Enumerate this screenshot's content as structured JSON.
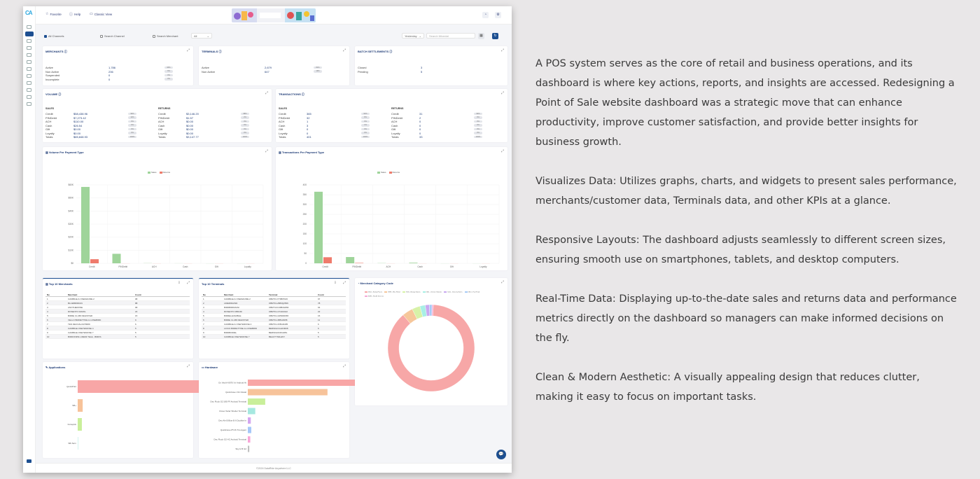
{
  "app": {
    "logo": "CA"
  },
  "topbar": {
    "favorite": "Favorite",
    "help": "Help",
    "classic": "Classic View"
  },
  "filters": {
    "all_channels": "All Channels",
    "search_channel": "Search Channel",
    "search_merchant": "Search Merchant",
    "all": "All",
    "period": "Yesterday",
    "date_placeholder": "Search Mixedat"
  },
  "merchants": {
    "title": "MERCHANTS",
    "rows": [
      {
        "label": "Active",
        "value": "1,786",
        "pill": "93%"
      },
      {
        "label": "Non Active",
        "value": "236",
        "pill": "6%"
      },
      {
        "label": "Suspended",
        "value": "0",
        "pill": "0%"
      },
      {
        "label": "Incomplete",
        "value": "0",
        "pill": "0%"
      }
    ]
  },
  "terminals": {
    "title": "TERMINALS",
    "rows": [
      {
        "label": "Active",
        "value": "2,679",
        "pill": "81%"
      },
      {
        "label": "Non Active",
        "value": "647",
        "pill": "19%"
      }
    ]
  },
  "batch": {
    "title": "BATCH SETTLEMENTS",
    "rows": [
      {
        "label": "Closed",
        "value": "3"
      },
      {
        "label": "Pending",
        "value": "5"
      }
    ]
  },
  "volume": {
    "title": "VOLUME",
    "sales_h": "SALES",
    "returns_h": "RETURNS",
    "sales": [
      {
        "label": "Credit",
        "value": "$58,438.96",
        "pill": "94%"
      },
      {
        "label": "PINDebit",
        "value": "$7,273.42",
        "pill": "12%"
      },
      {
        "label": "ACH",
        "value": "$110.00",
        "pill": "0%"
      },
      {
        "label": "Cash",
        "value": "$26.54",
        "pill": "0%"
      },
      {
        "label": "Gift",
        "value": "$0.00",
        "pill": "0%"
      },
      {
        "label": "Loyalty",
        "value": "$0.00",
        "pill": "0%"
      },
      {
        "label": "Totals",
        "value": "$65,848.93",
        "pill": "100%"
      }
    ],
    "returns": [
      {
        "label": "Credit",
        "value": "$3,146.20",
        "pill": "98%"
      },
      {
        "label": "PINDebit",
        "value": "$1.57",
        "pill": "2%"
      },
      {
        "label": "ACH",
        "value": "$0.00",
        "pill": "0%"
      },
      {
        "label": "Cash",
        "value": "$0.00",
        "pill": "0%"
      },
      {
        "label": "Gift",
        "value": "$0.00",
        "pill": "0%"
      },
      {
        "label": "Loyalty",
        "value": "$0.00",
        "pill": "0%"
      },
      {
        "label": "Totals",
        "value": "$3,147.77",
        "pill": "100%"
      }
    ]
  },
  "transactions": {
    "title": "TRANSACTIONS",
    "sales_h": "SALES",
    "returns_h": "RETURNS",
    "sales": [
      {
        "label": "Credit",
        "value": "365",
        "pill": "91%"
      },
      {
        "label": "PINDebit",
        "value": "32",
        "pill": "8%"
      },
      {
        "label": "ACH",
        "value": "1",
        "pill": "0%"
      },
      {
        "label": "Cash",
        "value": "3",
        "pill": "1%"
      },
      {
        "label": "Gift",
        "value": "0",
        "pill": "0%"
      },
      {
        "label": "Loyalty",
        "value": "0",
        "pill": "0%"
      },
      {
        "label": "Totals",
        "value": "401",
        "pill": "100%"
      }
    ],
    "returns": [
      {
        "label": "Credit",
        "value": "31",
        "pill": "94%"
      },
      {
        "label": "PINDebit",
        "value": "2",
        "pill": "6%"
      },
      {
        "label": "ACH",
        "value": "0",
        "pill": "0%"
      },
      {
        "label": "Cash",
        "value": "0",
        "pill": "0%"
      },
      {
        "label": "Gift",
        "value": "0",
        "pill": "0%"
      },
      {
        "label": "Loyalty",
        "value": "0",
        "pill": "0%"
      },
      {
        "label": "Totals",
        "value": "33",
        "pill": "100%"
      }
    ]
  },
  "colors": {
    "sales": "#9fd49a",
    "returns": "#ef7b6c",
    "accent": "#1d4f91"
  },
  "chart_data": [
    {
      "type": "bar",
      "title": "Volume Per Payment Type",
      "categories": [
        "Credit",
        "PINDebit",
        "ACH",
        "Cash",
        "Gift",
        "Loyalty"
      ],
      "series": [
        {
          "name": "Sales",
          "values": [
            58438.96,
            7273.42,
            110,
            26.54,
            0,
            0
          ]
        },
        {
          "name": "Returns",
          "values": [
            3146.2,
            1.57,
            0,
            0,
            0,
            0
          ]
        }
      ],
      "yticks": [
        "$0",
        "$10K",
        "$20K",
        "$30K",
        "$40K",
        "$50K",
        "$60K"
      ],
      "ylim": [
        0,
        60000
      ]
    },
    {
      "type": "bar",
      "title": "Transactions Per Payment Type",
      "categories": [
        "Credit",
        "PINDebit",
        "ACH",
        "Cash",
        "Gift",
        "Loyalty"
      ],
      "series": [
        {
          "name": "Sales",
          "values": [
            365,
            32,
            1,
            3,
            0,
            0
          ]
        },
        {
          "name": "Returns",
          "values": [
            31,
            2,
            0,
            0,
            0,
            0
          ]
        }
      ],
      "yticks": [
        "0",
        "50",
        "100",
        "150",
        "200",
        "250",
        "300",
        "350",
        "400"
      ],
      "ylim": [
        0,
        400
      ]
    },
    {
      "type": "bar",
      "title": "Applications",
      "categories": [
        "QuickPrint",
        "SB+",
        "Fortepick",
        "SB-Term"
      ],
      "values": [
        790,
        30,
        25,
        2
      ],
      "colors": [
        "#f8a6a6",
        "#f7c39a",
        "#c9ef9a",
        "#a6e8e0"
      ],
      "xlim": [
        0,
        800
      ]
    },
    {
      "type": "bar",
      "title": "Hardware",
      "categories": [
        "Ox Vital A-8070 Vx Android Ht",
        "QuickCave V1C Retail",
        "Dec Flock G2 S/B FF Android Terminal",
        "Clover Solar Shelter Terminal",
        "Dec Ale B Blue B 6 Doolitte In",
        "QuickCave 8*1/S Trio Agent",
        "Dec Flock G2 HC Android Terminal",
        "Sky H B G2"
      ],
      "values": [
        240,
        160,
        35,
        15,
        6,
        7,
        5,
        3
      ],
      "colors": [
        "#f8a6a6",
        "#f7c39a",
        "#c9ef9a",
        "#a6e8e0",
        "#d4a6f0",
        "#a6c8f8",
        "#f8a6d8",
        "#c0c0c0"
      ],
      "xlim": [
        0,
        260
      ]
    },
    {
      "type": "pie",
      "title": "Merchant Category Code",
      "series": [
        {
          "values": [
            88,
            4,
            3,
            2,
            1.5,
            1,
            0.5
          ]
        }
      ],
      "colors": [
        "#f7a7a7",
        "#f6c79b",
        "#d7f2a8",
        "#a8efe5",
        "#c9a9f0",
        "#a7cbf6",
        "#f4a8d6"
      ]
    }
  ],
  "volume_chart": {
    "title": "Volume Per Payment Type",
    "legend_sales": "Sales",
    "legend_returns": "Returns"
  },
  "tx_chart": {
    "title": "Transactions Per Payment Type",
    "legend_sales": "Sales",
    "legend_returns": "Returns"
  },
  "top_merchants": {
    "title": "Top 10 Merchants",
    "headers": [
      "No",
      "Merchant",
      "Count"
    ],
    "rows": [
      [
        "1",
        "CAMBIGE & ONEMAOME 2",
        "98"
      ],
      [
        "2",
        "BLUEBIRDFAN",
        "88"
      ],
      [
        "3",
        "ANOTHERONE",
        "68"
      ],
      [
        "4",
        "ROSENTO FAMOL",
        "22"
      ],
      [
        "5",
        "BIRRE CLUBI REGISTER",
        "15"
      ],
      [
        "6",
        "VELLO BIRRETTINE & LONEBIRD",
        "9"
      ],
      [
        "7",
        "TEN DECOALUM BIRD",
        "6"
      ],
      [
        "8",
        "CAMBIGE ONETEMONE 4",
        "5"
      ],
      [
        "9",
        "CAMBIGE ONETEMONE 7",
        "5"
      ],
      [
        "10",
        "BIRDONIPE LIREMI TELE - BIRDS",
        "5"
      ]
    ]
  },
  "top_terminals": {
    "title": "Top 10 Terminals",
    "headers": [
      "No",
      "Merchant",
      "Terminal",
      "Count"
    ],
    "rows": [
      [
        "1",
        "CAMBIGE & ONEMAOME 2",
        "OBRTCU7788X5G5",
        "97"
      ],
      [
        "2",
        "LIREMIRAIND",
        "OBRTCL2883Q2566",
        "78"
      ],
      [
        "3",
        "BIRDBIRDMANI",
        "OBRT1CC4884G866",
        "64"
      ],
      [
        "4",
        "ROSENTO RBIUID",
        "OBRTCL17G944G0",
        "22"
      ],
      [
        "5",
        "BIRRELEVARBLE",
        "OBRTCL1W998J665",
        "15"
      ],
      [
        "6",
        "BIRRE CLUBI REGISTER",
        "OBRTCL3B5G8458",
        "11"
      ],
      [
        "7",
        "CAMBIGE & ONETEMONE 4",
        "OBRTCL3X8G9G85",
        "6"
      ],
      [
        "8",
        "LIOCO BIRRETTINE & LONEBIRD",
        "BERSKHCGHF0008",
        "6"
      ],
      [
        "9",
        "BIRDBOIREL",
        "BERSKH0CRG08G",
        "5"
      ],
      [
        "10",
        "CAMBIGE ONETEMONE 7",
        "BEAUTYMILENY",
        "5"
      ]
    ]
  },
  "apps_title": "Applications",
  "hardware_title": "Hardware",
  "mcc_title": "Merchant Category Code",
  "mcc_legend": [
    "5812 - Eating Places",
    "5999 - Misc Retail",
    "7230 - Beauty Salons",
    "5541 - Service Stations",
    "5411 - Grocery Stores",
    "5814 - Fast Food",
    "8099 - Health Services"
  ],
  "footer": "©2024 DataRide Anywhere LLC",
  "description": [
    "A POS system serves as the core of retail and business operations, and its dashboard is where key actions, reports, and insights are accessed. Redesigning a Point of Sale website dashboard was a strategic move that can enhance productivity, improve customer satisfaction, and provide better insights for business growth.",
    "Visualizes Data: Utilizes graphs, charts, and widgets to present sales performance, merchants/customer data, Terminals data, and other KPIs at a glance.",
    "Responsive Layouts: The dashboard adjusts seamlessly to different screen sizes, ensuring smooth use on smartphones, tablets, and desktop computers.",
    "Real-Time Data: Displaying up-to-the-date sales and returns data and performance metrics directly on the dashboard so managers can make informed decisions on the fly.",
    "Clean & Modern Aesthetic: A visually appealing design that reduces clutter, making it easy to focus on important tasks."
  ]
}
